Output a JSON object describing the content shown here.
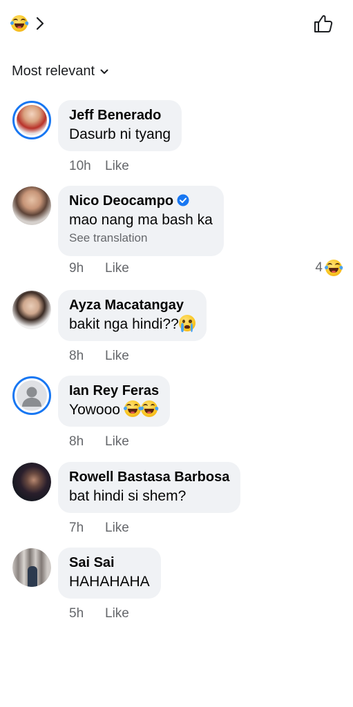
{
  "top_bar": {
    "reaction_icon": "laughing-face-icon",
    "chevron_icon": "chevron-right-icon",
    "like_icon": "thumbs-up-icon"
  },
  "sort": {
    "label": "Most relevant",
    "icon": "chevron-down-icon"
  },
  "comments": [
    {
      "author": "Jeff Benerado",
      "text": "Dasurb ni tyang",
      "time": "10h",
      "like_label": "Like",
      "avatar_ring": true
    },
    {
      "author": "Nico Deocampo",
      "verified": true,
      "text": "mao nang ma bash ka",
      "see_translation": "See translation",
      "time": "9h",
      "like_label": "Like",
      "reaction_count": "4",
      "reaction_icon": "laughing-face-icon"
    },
    {
      "author": "Ayza Macatangay",
      "text": "bakit nga hindi??",
      "text_emoji": "crying-face-icon",
      "time": "8h",
      "like_label": "Like"
    },
    {
      "author": "Ian Rey Feras",
      "text": "Yowooo",
      "text_emoji": "laughing-face-icon",
      "time": "8h",
      "like_label": "Like",
      "avatar_ring": true
    },
    {
      "author": "Rowell Bastasa Barbosa",
      "text": "bat hindi si shem?",
      "time": "7h",
      "like_label": "Like"
    },
    {
      "author": "Sai Sai",
      "text": "HAHAHAHA",
      "time": "5h",
      "like_label": "Like"
    }
  ],
  "colors": {
    "bubble_bg": "#f0f2f5",
    "meta_text": "#65676b",
    "verified_blue": "#1877f2",
    "story_ring": "#1877f2"
  }
}
